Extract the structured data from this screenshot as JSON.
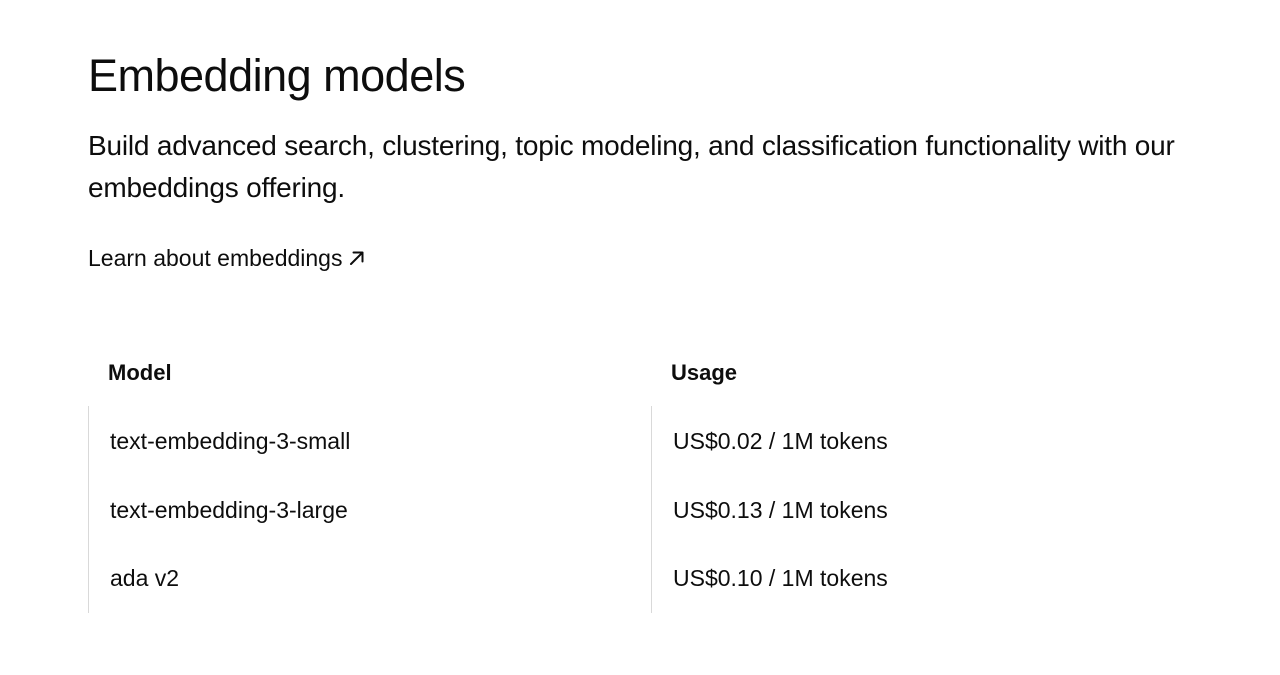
{
  "section": {
    "title": "Embedding models",
    "description": "Build advanced search, clustering, topic modeling, and classification functionality with our embeddings offering.",
    "link": {
      "label": "Learn about embeddings",
      "icon": "arrow-up-right-icon"
    }
  },
  "table": {
    "headers": {
      "model": "Model",
      "usage": "Usage"
    },
    "rows": [
      {
        "model": "text-embedding-3-small",
        "usage": "US$0.02 / 1M tokens"
      },
      {
        "model": "text-embedding-3-large",
        "usage": "US$0.13 / 1M tokens"
      },
      {
        "model": "ada v2",
        "usage": "US$0.10 / 1M tokens"
      }
    ]
  },
  "colors": {
    "text": "#0d0d0d",
    "background": "#ffffff",
    "divider": "#d9d9d9"
  }
}
